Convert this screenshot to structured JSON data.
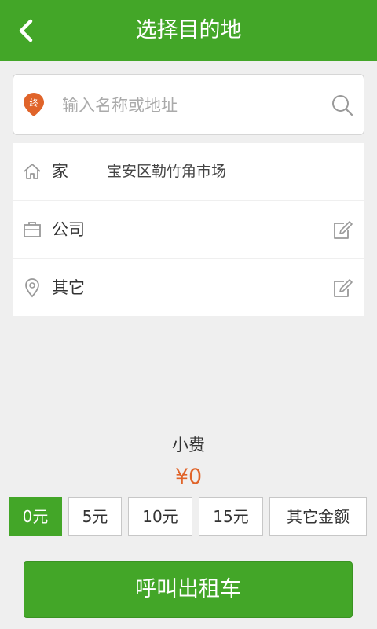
{
  "header": {
    "title": "选择目的地",
    "back_icon": "chevron-left-icon"
  },
  "search": {
    "placeholder": "输入名称或地址",
    "value": "",
    "pin_badge": "终",
    "pin_color": "#e0642a",
    "search_icon": "search-icon"
  },
  "list": [
    {
      "icon": "home-icon",
      "label": "家",
      "value": "宝安区勒竹角市场"
    },
    {
      "icon": "briefcase-icon",
      "label": "公司",
      "edit_icon": "edit-icon"
    },
    {
      "icon": "location-icon",
      "label": "其它",
      "edit_icon": "edit-icon"
    }
  ],
  "tip": {
    "label": "小费",
    "amount": "¥0",
    "options": [
      "0元",
      "5元",
      "10元",
      "15元",
      "其它金额"
    ],
    "selected": "0元"
  },
  "call_button": {
    "label": "呼叫出租车"
  },
  "colors": {
    "brand": "#43a628",
    "accent": "#e0642a",
    "background": "#efefef"
  }
}
